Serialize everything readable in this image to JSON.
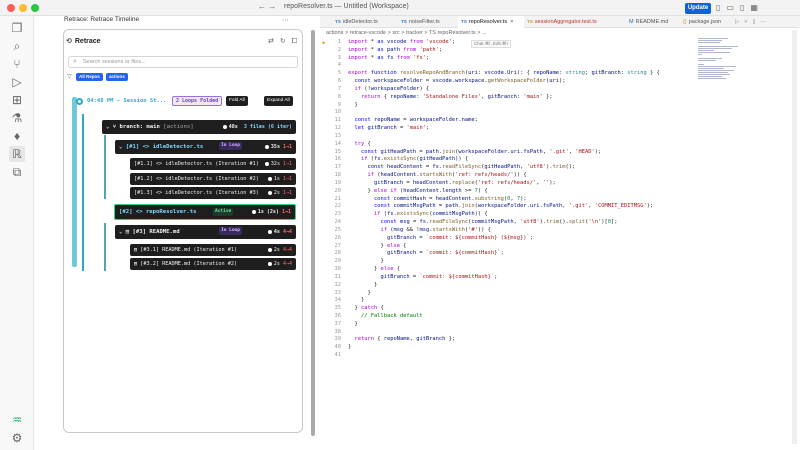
{
  "titlebar": {
    "title": "repoResolver.ts — Untitled (Workspace)",
    "update_label": "Update"
  },
  "side_panel": {
    "header": "Retrace: Retrace Timeline",
    "title": "Retrace",
    "search_placeholder": "Search sessions or files...",
    "filters": [
      "All Repos",
      "actions"
    ]
  },
  "session": {
    "time": "04:48 PM - Session St...",
    "loops_badge": "2 Loops Folded",
    "fold_label": "Fold All",
    "expand_label": "Expand All",
    "branch": {
      "label": "branch: main",
      "tag": "[actions]",
      "duration": "48s",
      "files": "3 files (6 iter)"
    },
    "files": [
      {
        "label": "[#1] <> idleDetector.ts",
        "loop": "In Loop",
        "duration": "35s",
        "lines": "1→1",
        "iterations": [
          {
            "label": "[#1.1] <> idleDetector.ts (Iteration #1)",
            "duration": "32s",
            "lines": "1→1"
          },
          {
            "label": "[#1.2] <> idleDetector.ts (Iteration #2)",
            "duration": "1s",
            "lines": "1→1"
          },
          {
            "label": "[#1.3] <> idleDetector.ts (Iteration #3)",
            "duration": "2s",
            "lines": "1→1"
          }
        ]
      },
      {
        "label": "[#2] <> repoResolver.ts",
        "active": "Active",
        "duration": "1s",
        "time": "(2s)",
        "lines": "1→1",
        "iterations": []
      },
      {
        "label": "[#3] README.md",
        "loop": "In Loop",
        "duration": "4s",
        "lines": "4→4",
        "iterations": [
          {
            "label": "[#3.1] README.md (Iteration #1)",
            "duration": "2s",
            "lines": "4→4"
          },
          {
            "label": "[#3.2] README.md (Iteration #2)",
            "duration": "2s",
            "lines": "4→4"
          }
        ]
      }
    ]
  },
  "editor": {
    "tabs": [
      {
        "badge": "TS",
        "label": "idleDetector.ts"
      },
      {
        "badge": "TS",
        "label": "noiseFilter.ts"
      },
      {
        "badge": "TS",
        "label": "repoResolver.ts",
        "active": true
      },
      {
        "badge": "TS",
        "label": "sessionAggregator.test.ts",
        "test": true
      },
      {
        "badge": "M",
        "label": "README.md"
      },
      {
        "badge": "{}",
        "label": "package.json"
      }
    ],
    "breadcrumb": "actions > retrace-vscode > src > tracker > TS repoResolver.ts > ...",
    "chat_hint": "Chat ⌘I, Edit ⌘I",
    "line_count": 41,
    "lines": [
      "import * as vscode from 'vscode';",
      "import * as path from 'path';",
      "import * as fs from 'fs';",
      "",
      "export function resolveRepoAndBranch(uri: vscode.Uri): { repoName: string; gitBranch: string } {",
      "  const workspaceFolder = vscode.workspace.getWorkspaceFolder(uri);",
      "  if (!workspaceFolder) {",
      "    return { repoName: 'Standalone Files', gitBranch: 'main' };",
      "  }",
      "",
      "  const repoName = workspaceFolder.name;",
      "  let gitBranch = 'main';",
      "",
      "  try {",
      "    const gitHeadPath = path.join(workspaceFolder.uri.fsPath, '.git', 'HEAD');",
      "    if (fs.existsSync(gitHeadPath)) {",
      "      const headContent = fs.readFileSync(gitHeadPath, 'utf8').trim();",
      "      if (headContent.startsWith('ref: refs/heads/')) {",
      "        gitBranch = headContent.replace('ref: refs/heads/', '');",
      "      } else if (headContent.length >= 7) {",
      "        const commitHash = headContent.substring(0, 7);",
      "        const commitMsgPath = path.join(workspaceFolder.uri.fsPath, '.git', 'COMMIT_EDITMSG');",
      "        if (fs.existsSync(commitMsgPath)) {",
      "          const msg = fs.readFileSync(commitMsgPath, 'utf8').trim().split('\\n')[0];",
      "          if (msg && !msg.startsWith('#')) {",
      "            gitBranch = `commit: ${commitHash} (${msg})`;",
      "          } else {",
      "            gitBranch = `commit: ${commitHash}`;",
      "          }",
      "        } else {",
      "          gitBranch = `commit: ${commitHash}`;",
      "        }",
      "      }",
      "    }",
      "  } catch {",
      "    // Fallback default",
      "  }",
      "",
      "  return { repoName, gitBranch };",
      "}",
      ""
    ]
  }
}
